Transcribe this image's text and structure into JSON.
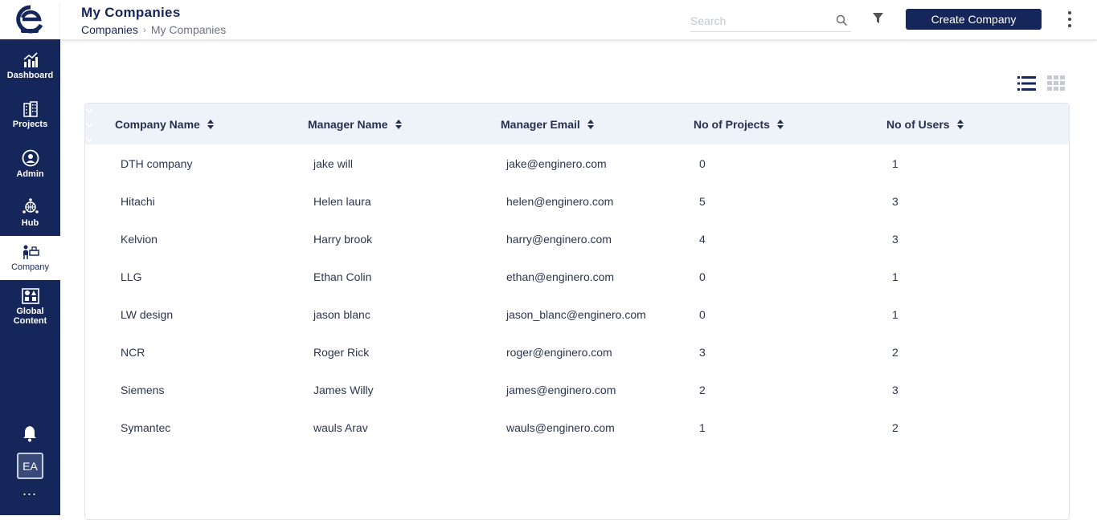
{
  "sidebar": {
    "items": [
      {
        "label": "Dashboard",
        "icon": "chart-growth-icon"
      },
      {
        "label": "Projects",
        "icon": "buildings-icon"
      },
      {
        "label": "Admin",
        "icon": "admin-user-icon"
      },
      {
        "label": "Hub",
        "icon": "hub-globe-icon"
      },
      {
        "label": "Company",
        "icon": "company-desk-icon",
        "active": true
      },
      {
        "label": "Global Content",
        "icon": "shapes-grid-icon"
      }
    ],
    "avatar_initials": "EA",
    "more_label": "..."
  },
  "header": {
    "title": "My Companies",
    "breadcrumb": {
      "root": "Companies",
      "separator": "›",
      "current": "My Companies"
    },
    "search_placeholder": "Search",
    "create_button": "Create Company"
  },
  "table": {
    "columns": [
      "Company Name",
      "Manager Name",
      "Manager Email",
      "No of Projects",
      "No of Users"
    ],
    "rows": [
      [
        "DTH company",
        "jake will",
        "jake@enginero.com",
        "0",
        "1"
      ],
      [
        "Hitachi",
        "Helen laura",
        "helen@enginero.com",
        "5",
        "3"
      ],
      [
        "Kelvion",
        "Harry brook",
        "harry@enginero.com",
        "4",
        "3"
      ],
      [
        "LLG",
        "Ethan Colin",
        "ethan@enginero.com",
        "0",
        "1"
      ],
      [
        "LW design",
        "jason blanc",
        "jason_blanc@enginero.com",
        "0",
        "1"
      ],
      [
        "NCR",
        "Roger Rick",
        "roger@enginero.com",
        "3",
        "2"
      ],
      [
        "Siemens",
        "James Willy",
        "james@enginero.com",
        "2",
        "3"
      ],
      [
        "Symantec",
        "wauls Arav",
        "wauls@enginero.com",
        "1",
        "2"
      ]
    ]
  },
  "colors": {
    "primary": "#15275a",
    "header_bg": "#eef2f9"
  }
}
